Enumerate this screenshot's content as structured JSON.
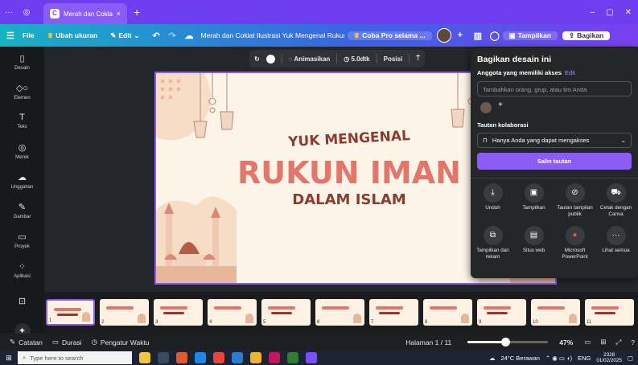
{
  "browser": {
    "tab_title": "Merah dan Coklat I...",
    "tab_close": "×",
    "new_tab": "+",
    "menu_icon": "···",
    "min": "–",
    "max": "▢",
    "close": "✕"
  },
  "toolbar": {
    "file": "File",
    "resize": "Ubah ukuran",
    "edit": "Edit",
    "doc_title": "Merah dan Coklat Ilustrasi Yuk Mengenal Rukun I...",
    "try_pro": "Coba Pro selama ...",
    "present": "Tampilkan",
    "share": "Bagikan"
  },
  "sidebar": {
    "items": [
      {
        "label": "Desain",
        "icon": "layout-icon"
      },
      {
        "label": "Elemen",
        "icon": "shapes-icon"
      },
      {
        "label": "Teks",
        "icon": "text-icon"
      },
      {
        "label": "Merek",
        "icon": "brand-icon"
      },
      {
        "label": "Unggahan",
        "icon": "upload-icon"
      },
      {
        "label": "Gambar",
        "icon": "draw-icon"
      },
      {
        "label": "Proyek",
        "icon": "folder-icon"
      },
      {
        "label": "Aplikasi",
        "icon": "apps-icon"
      }
    ]
  },
  "context_toolbar": {
    "animate": "Animasikan",
    "duration": "5.0dtk",
    "position": "Posisi"
  },
  "slide": {
    "line1": "YUK MENGENAL",
    "line2": "RUKUN IMAN",
    "line3": "DALAM ISLAM"
  },
  "share_panel": {
    "title": "Bagikan desain ini",
    "access_label": "Anggota yang memiliki akses",
    "edit_link": "Edit",
    "invite_placeholder": "Tambahkan orang, grup, atau tim Anda",
    "collab_label": "Tautan kolaborasi",
    "access_option": "Hanya Anda yang dapat mengakses",
    "copy_link": "Salin tautan",
    "actions": [
      {
        "label": "Unduh",
        "icon": "download-icon"
      },
      {
        "label": "Tampilkan",
        "icon": "present-icon"
      },
      {
        "label": "Tautan tampilan publik",
        "icon": "link-icon"
      },
      {
        "label": "Cetak dengan Canva",
        "icon": "print-truck-icon"
      },
      {
        "label": "Tampilkan dan rekam",
        "icon": "record-icon"
      },
      {
        "label": "Situs web",
        "icon": "website-icon"
      },
      {
        "label": "Microsoft PowerPoint",
        "icon": "powerpoint-icon"
      },
      {
        "label": "Lihat semua",
        "icon": "more-icon"
      }
    ]
  },
  "thumbnails": [
    "1",
    "2",
    "3",
    "4",
    "5",
    "6",
    "7",
    "8",
    "9",
    "10",
    "11"
  ],
  "bottom": {
    "notes": "Catatan",
    "duration": "Durasi",
    "timer": "Pengatur Waktu",
    "page": "Halaman 1 / 11",
    "zoom": "47%",
    "zoom_fraction": 0.47
  },
  "taskbar": {
    "search_placeholder": "Type here to search",
    "weather": "24°C Berawan",
    "lang": "ENG",
    "time": "2328",
    "date": "01/02/2025"
  },
  "colors": {
    "accent": "#8b5cf6",
    "slide_bg": "#fdf4e8",
    "title_red": "#e3756b",
    "title_brown": "#8e3b2f"
  }
}
